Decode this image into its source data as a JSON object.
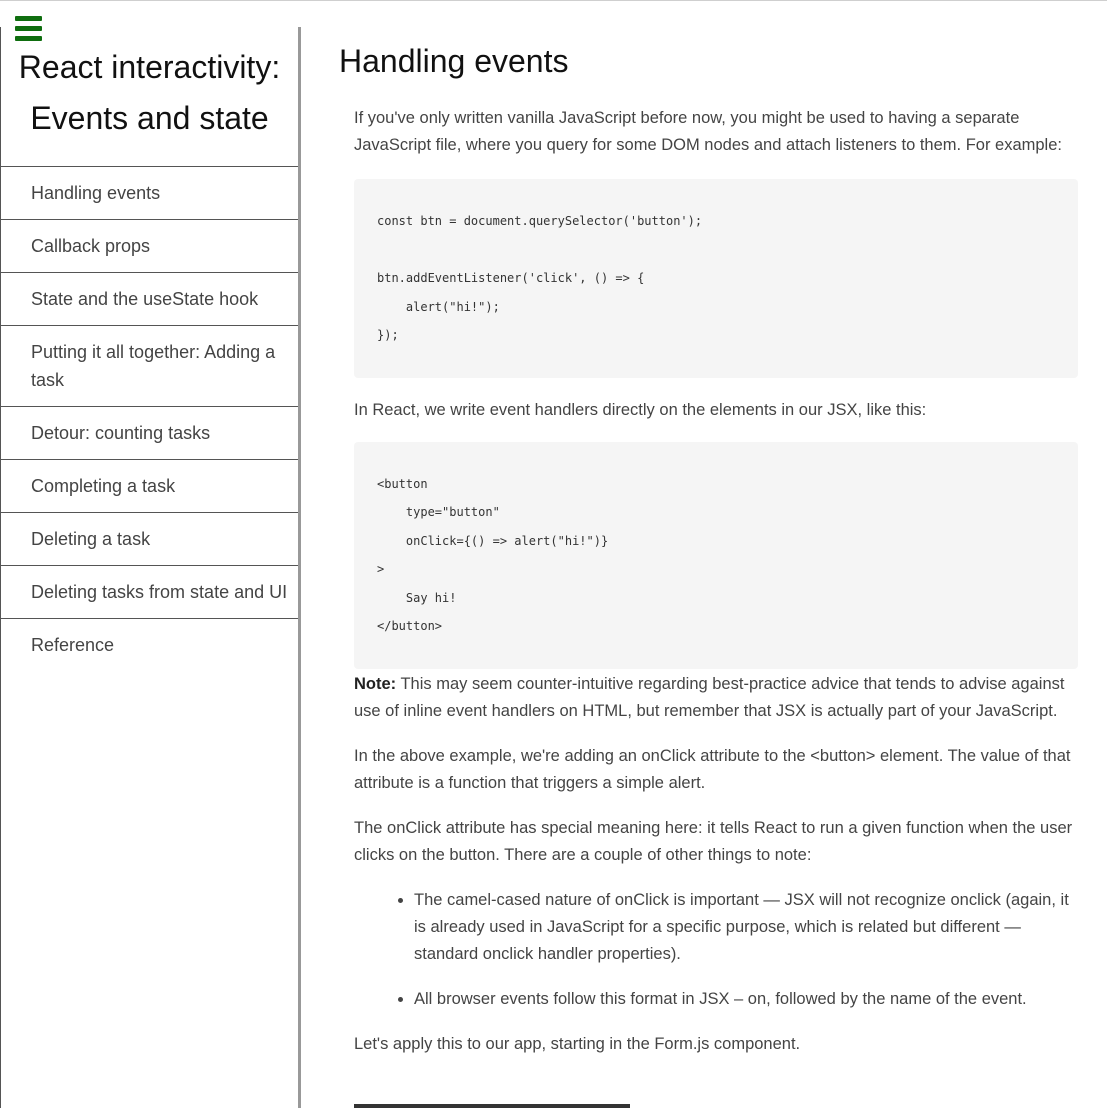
{
  "sidebar": {
    "title_line1": "React interactivity:",
    "title_line2": "Events and state",
    "items": [
      "Handling events",
      "Callback props",
      "State and the useState hook",
      "Putting it all together: Adding a task",
      "Detour: counting tasks",
      "Completing a task",
      "Deleting a task",
      "Deleting tasks from state and UI",
      "Reference"
    ]
  },
  "main": {
    "title": "Handling events",
    "intro": "If you've only written vanilla JavaScript before now, you might be used to having a separate JavaScript file, where you query for some DOM nodes and attach listeners to them. For example:",
    "code1": [
      "const btn = document.querySelector('button');",
      "",
      "btn.addEventListener('click', () => {",
      "    alert(\"hi!\");",
      "});"
    ],
    "react_text": "In React, we write event handlers directly on the elements in our JSX, like this:",
    "code2": [
      "<button",
      "    type=\"button\"",
      "    onClick={() => alert(\"hi!\")}",
      ">",
      "    Say hi!",
      "</button>"
    ],
    "note_label": "Note:",
    "note_text": " This may seem counter-intuitive regarding best-practice advice that tends to advise against use of inline event handlers on HTML, but remember that JSX is actually part of your JavaScript.",
    "para_above": "In the above example, we're adding an onClick attribute to the <button> element. The value of that attribute is a function that triggers a simple alert.",
    "para_onclick": "The onClick attribute has special meaning here: it tells React to run a given function when the user clicks on the button. There are a couple of other things to note:",
    "bullets": [
      "The camel-cased nature of onClick is important — JSX will not recognize onclick (again, it is already used in JavaScript for a specific purpose, which is related but different — standard onclick handler properties).",
      "All browser events follow this format in JSX – on, followed by the name of the event."
    ],
    "para_apply": "Let's apply this to our app, starting in the Form.js component."
  }
}
